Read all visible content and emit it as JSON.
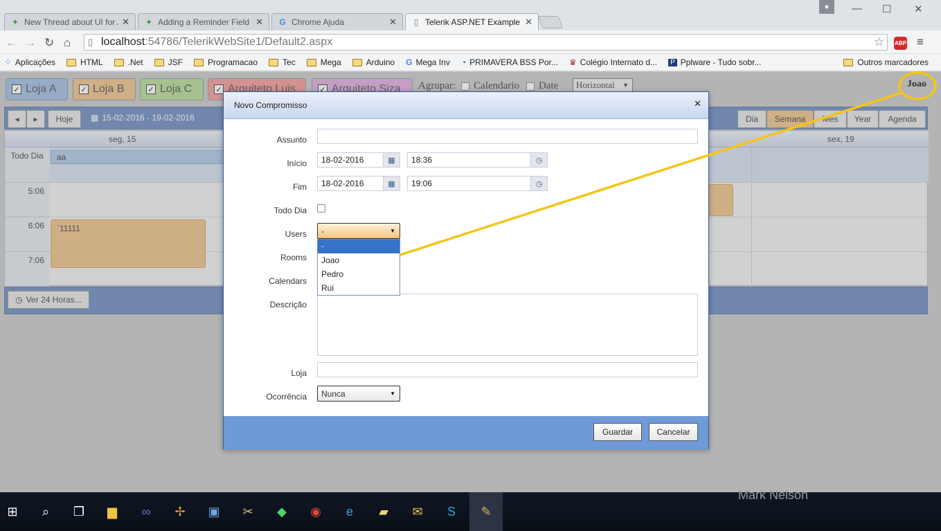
{
  "browser": {
    "tabs": [
      {
        "title": "New Thread about UI for A",
        "icon": "telerik-icon"
      },
      {
        "title": "Adding a Reminder Field |",
        "icon": "telerik-icon"
      },
      {
        "title": "Chrome Ajuda",
        "icon": "google-icon"
      },
      {
        "title": "Telerik ASP.NET Example",
        "icon": "page-icon"
      }
    ],
    "url_host": "localhost",
    "url_rest": ":54786/TelerikWebSite1/Default2.aspx",
    "adblock_label": "ABP",
    "bookmarks": [
      {
        "label": "Aplicações"
      },
      {
        "label": "HTML"
      },
      {
        "label": ".Net"
      },
      {
        "label": "JSF"
      },
      {
        "label": "Programacao"
      },
      {
        "label": "Tec"
      },
      {
        "label": "Mega"
      },
      {
        "label": "Arduino"
      },
      {
        "label": "Mega Inv"
      },
      {
        "label": "PRIMAVERA BSS Por..."
      },
      {
        "label": "Colégio Internato d..."
      },
      {
        "label": "Pplware - Tudo sobr..."
      }
    ],
    "other_bookmarks": "Outros marcadores"
  },
  "page": {
    "resources": [
      {
        "label": "Loja A",
        "color": "#aac4e4"
      },
      {
        "label": "Loja B",
        "color": "#f0c896"
      },
      {
        "label": "Loja C",
        "color": "#bfe0a0"
      },
      {
        "label": "Arquiteto Luis",
        "color": "#f4a4a4"
      },
      {
        "label": "Arquiteto Siza",
        "color": "#e2b4e2"
      }
    ],
    "group_label": "Agrupar:",
    "group_calendar": "Calendario",
    "group_date": "Date",
    "group_orientation": "Horizontal",
    "user_name": "Joao",
    "nav_prev": "◂",
    "nav_next": "▸",
    "today": "Hoje",
    "date_range": "15-02-2016 - 19-02-2016",
    "views": [
      "Dia",
      "Semana",
      "Mes",
      "Year",
      "Agenda"
    ],
    "day_headers": [
      "seg, 15",
      "sex, 19"
    ],
    "allday_label": "Todo Dia",
    "allday_event": "aa",
    "times": [
      "5:06",
      "6:06",
      "7:06"
    ],
    "event_label": "`11111",
    "show_24h": "Ver 24 Horas..."
  },
  "modal": {
    "title": "Novo Compromisso",
    "labels": {
      "subject": "Assunto",
      "start": "Início",
      "end": "Fim",
      "allday": "Todo Dia",
      "users": "Users",
      "rooms": "Rooms",
      "calendars": "Calendars",
      "description": "Descrição",
      "store": "Loja",
      "recurrence": "Ocorrência"
    },
    "start_date": "18-02-2016",
    "start_time": "18:36",
    "end_date": "18-02-2016",
    "end_time": "19:06",
    "users_selected": "-",
    "users_options": [
      "-",
      "Joao",
      "Pedro",
      "Rui"
    ],
    "recurrence_value": "Nunca",
    "save": "Guardar",
    "cancel": "Cancelar"
  },
  "taskbar": {
    "wallpaper_text": "Mark Nelson"
  },
  "colors": {
    "annotation": "#f5c518",
    "header_blue": "#7d98c6",
    "selected_option": "#3572c9"
  }
}
